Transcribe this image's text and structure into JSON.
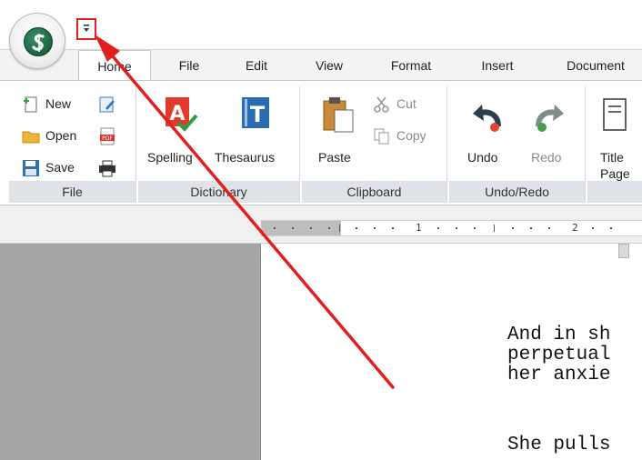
{
  "app": {
    "icon": "app-logo-icon",
    "qat_dropdown_icon": "dropdown-caret-icon"
  },
  "tabs": [
    {
      "label": "Home",
      "active": true
    },
    {
      "label": "File"
    },
    {
      "label": "Edit"
    },
    {
      "label": "View"
    },
    {
      "label": "Format"
    },
    {
      "label": "Insert"
    },
    {
      "label": "Document"
    }
  ],
  "ribbon": {
    "file_group": {
      "label": "File",
      "new": "New",
      "open": "Open",
      "save": "Save",
      "icons": [
        "new-document-icon",
        "open-folder-icon",
        "save-disk-icon",
        "edit-document-icon",
        "pdf-icon",
        "print-icon"
      ]
    },
    "dictionary_group": {
      "label": "Dictionary",
      "spelling": "Spelling",
      "thesaurus": "Thesaurus"
    },
    "clipboard_group": {
      "label": "Clipboard",
      "paste": "Paste",
      "cut": "Cut",
      "copy": "Copy"
    },
    "undo_group": {
      "label": "Undo/Redo",
      "undo": "Undo",
      "redo": "Redo"
    },
    "page_group": {
      "title_line1": "Title",
      "title_line2": "Page"
    }
  },
  "ruler": {
    "marks": [
      "1",
      "2"
    ]
  },
  "document": {
    "lines": [
      "And in sh",
      "perpetual",
      "her anxie",
      "",
      "She pulls"
    ]
  },
  "annotation": {
    "color": "#e02020",
    "target": "quick-access-dropdown"
  },
  "colors": {
    "accent_green": "#1f6b48",
    "annotation_red": "#e02020",
    "group_label_bg": "#dfe3e8"
  }
}
